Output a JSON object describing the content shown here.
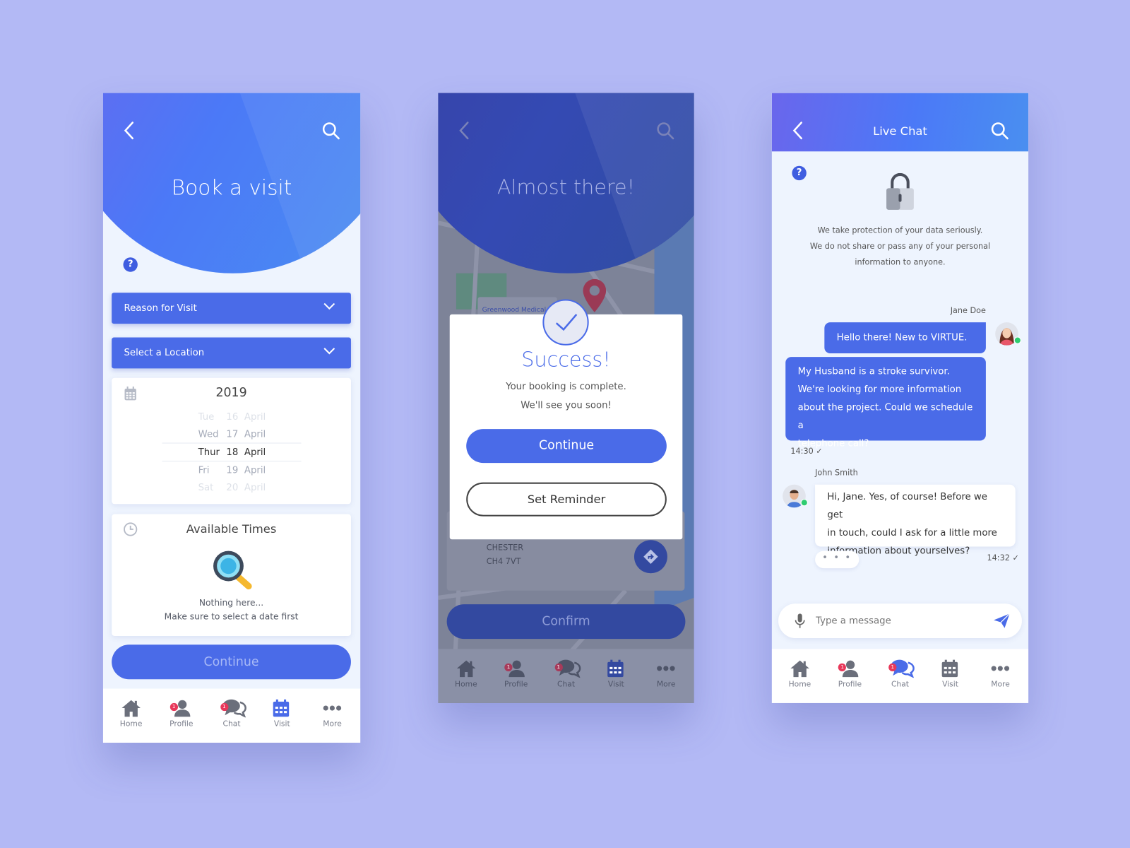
{
  "colors": {
    "background": "#b3b9f5",
    "primary": "#4a6be8",
    "badge": "#e8385a",
    "online": "#2ecc71"
  },
  "nav_items": [
    {
      "label": "Home",
      "icon": "home-icon"
    },
    {
      "label": "Profile",
      "icon": "profile-icon",
      "badge": "1"
    },
    {
      "label": "Chat",
      "icon": "chat-icon",
      "badge": "1"
    },
    {
      "label": "Visit",
      "icon": "calendar-icon"
    },
    {
      "label": "More",
      "icon": "more-icon"
    }
  ],
  "book": {
    "title": "Book a visit",
    "reason_label": "Reason for Visit",
    "location_label": "Select a Location",
    "year": "2019",
    "dates": [
      {
        "day": "Tue",
        "date": "16",
        "month": "April"
      },
      {
        "day": "Wed",
        "date": "17",
        "month": "April"
      },
      {
        "day": "Thur",
        "date": "18",
        "month": "April",
        "selected": true
      },
      {
        "day": "Fri",
        "date": "19",
        "month": "April"
      },
      {
        "day": "Sat",
        "date": "20",
        "month": "April"
      }
    ],
    "times_title": "Available Times",
    "empty_title": "Nothing here...",
    "empty_hint": "Make sure to select a date first",
    "continue_label": "Continue",
    "active_nav": "Visit"
  },
  "success": {
    "title": "Almost there!",
    "map_label": "Greenwood Medical",
    "heading": "Success!",
    "line1": "Your booking is complete.",
    "line2": "We'll see you soon!",
    "continue_label": "Continue",
    "reminder_label": "Set Reminder",
    "address_city": "CHESTER",
    "address_postcode": "CH4 7VT",
    "confirm_label": "Confirm",
    "active_nav": "Visit"
  },
  "chat": {
    "title": "Live Chat",
    "privacy": [
      "We take protection of your data seriously.",
      "We do not share or pass any of your personal",
      "information to anyone."
    ],
    "user_name": "Jane Doe",
    "msg1": "Hello there! New to VIRTUE.",
    "msg2": [
      "My Husband is a stroke survivor.",
      "We're looking for more information",
      "about the project. Could we schedule a",
      "telephone call?"
    ],
    "time1": "14:30",
    "agent_name": "John Smith",
    "msg3": [
      "Hi, Jane. Yes, of course! Before we get",
      "in touch, could I ask for a little more",
      "information about yourselves?"
    ],
    "time2": "14:32",
    "input_placeholder": "Type a message",
    "active_nav": "Chat"
  }
}
